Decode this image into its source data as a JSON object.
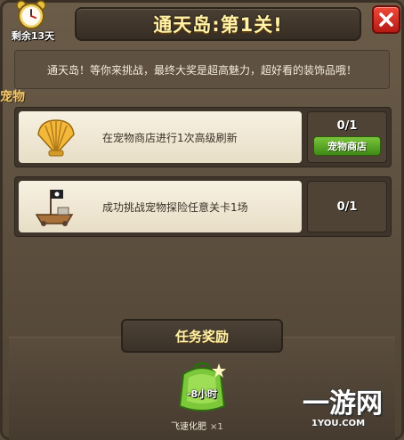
{
  "header": {
    "title": "通天岛:第1关!",
    "days_left": "剩余13天"
  },
  "description": "通天岛！等你来挑战，最终大奖是超高魅力，超好看的装饰品哦！",
  "section_label": "宠物",
  "tasks": [
    {
      "text": "在宠物商店进行1次高级刷新",
      "progress": "0/1",
      "button_label": "宠物商店",
      "icon": "shell-icon"
    },
    {
      "text": "成功挑战宠物探险任意关卡1场",
      "progress": "0/1",
      "icon": "pirate-ship-icon"
    }
  ],
  "reward": {
    "title": "任务奖励",
    "item_name": "飞速化肥",
    "quantity": "×1",
    "timer_label": "-8小时"
  },
  "watermark": {
    "text": "一游网",
    "sub": "1YOU.COM"
  },
  "colors": {
    "accent_title": "#fff3a8",
    "green_button": "#5aa626",
    "close_red": "#d4281e"
  }
}
